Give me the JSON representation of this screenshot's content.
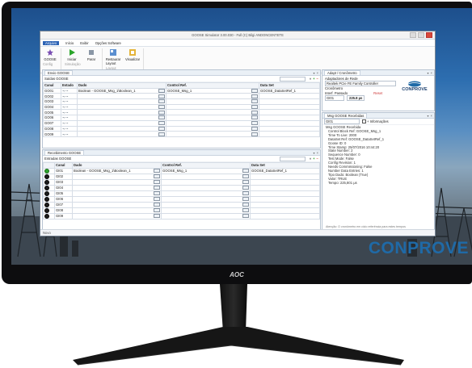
{
  "monitor": {
    "brand_logo": "AOC",
    "wallpaper_brand": "CONPROVE"
  },
  "app": {
    "title": "GOOSE Simulator 3.00.030 - Full (C) Bilgi ANDONCENTETE",
    "menu": [
      "Arquivo",
      "Início",
      "Exibir",
      "Opções Software"
    ],
    "menu_active_index": 1,
    "ribbon": {
      "groups": [
        {
          "caption": "Config",
          "buttons": [
            {
              "label": "GOOSE",
              "icon": "goose-icon"
            }
          ]
        },
        {
          "caption": "Simulação",
          "buttons": [
            {
              "label": "Iniciar",
              "icon": "play-icon"
            },
            {
              "label": "Parar",
              "icon": "stop-icon"
            }
          ]
        },
        {
          "caption": "Layout",
          "buttons": [
            {
              "label": "Restaurar Layout",
              "icon": "restore-layout-icon"
            },
            {
              "label": "Visualizar",
              "icon": "view-icon"
            }
          ]
        }
      ]
    },
    "envio_panel": {
      "tab": "Envio GOOSE",
      "subtitle": "Saídas GOOSE",
      "columns": [
        "Canal",
        "Estado",
        "Dado",
        "Control Ref.",
        "Data Set"
      ],
      "rows": [
        {
          "canal": "GO01",
          "estado": "~⌐~",
          "dado": "Boolean - GOOSE_Msg_1\\Boolean_1",
          "control": "GOOSE_Msg_1",
          "dataset": "GOOSE_DataSetRef_1"
        },
        {
          "canal": "GO02",
          "estado": "~⌐~",
          "dado": "",
          "control": "",
          "dataset": ""
        },
        {
          "canal": "GO03",
          "estado": "~⌐~",
          "dado": "",
          "control": "",
          "dataset": ""
        },
        {
          "canal": "GO04",
          "estado": "~⌐~",
          "dado": "",
          "control": "",
          "dataset": ""
        },
        {
          "canal": "GO05",
          "estado": "~⌐~",
          "dado": "",
          "control": "",
          "dataset": ""
        },
        {
          "canal": "GO06",
          "estado": "~⌐~",
          "dado": "",
          "control": "",
          "dataset": ""
        },
        {
          "canal": "GO07",
          "estado": "~⌐~",
          "dado": "",
          "control": "",
          "dataset": ""
        },
        {
          "canal": "GO08",
          "estado": "~⌐~",
          "dado": "",
          "control": "",
          "dataset": ""
        },
        {
          "canal": "GO09",
          "estado": "~⌐~",
          "dado": "",
          "control": "",
          "dataset": ""
        }
      ]
    },
    "recebimento_panel": {
      "tab": "Recebimento GOOSE",
      "subtitle": "Entradas GOOSE",
      "columns": [
        "",
        "Canal",
        "Dado",
        "Control Ref.",
        "Data Set"
      ],
      "rows": [
        {
          "led": "green",
          "canal": "GI01",
          "dado": "Boolean - GOOSE_Msg_1\\Boolean_1",
          "control": "GOOSE_Msg_1",
          "dataset": "GOOSE_DataSetRef_1"
        },
        {
          "led": "dark",
          "canal": "GI02",
          "dado": "",
          "control": "",
          "dataset": ""
        },
        {
          "led": "dark",
          "canal": "GI03",
          "dado": "",
          "control": "",
          "dataset": ""
        },
        {
          "led": "dark",
          "canal": "GI04",
          "dado": "",
          "control": "",
          "dataset": ""
        },
        {
          "led": "dark",
          "canal": "GI05",
          "dado": "",
          "control": "",
          "dataset": ""
        },
        {
          "led": "dark",
          "canal": "GI06",
          "dado": "",
          "control": "",
          "dataset": ""
        },
        {
          "led": "dark",
          "canal": "GI07",
          "dado": "",
          "control": "",
          "dataset": ""
        },
        {
          "led": "dark",
          "canal": "GI08",
          "dado": "",
          "control": "",
          "dataset": ""
        },
        {
          "led": "dark",
          "canal": "GI09",
          "dado": "",
          "control": "",
          "dataset": ""
        }
      ]
    },
    "adapter_panel": {
      "tab": "Adapt / Cronômetro",
      "section": "Adaptadores de Rede",
      "adapter_value": "Realtek PCIe FE Family Controller",
      "chrono_label": "Cronômetro",
      "chrono_sub": "Interf. Passado",
      "chrono_reset": "Reset",
      "chrono_channel": "GI01",
      "chrono_value": "225.8 µs",
      "logo_text": "CONPROVE"
    },
    "msg_panel": {
      "tab": "Msg GOOSE Recebidas",
      "select_value": "GI01",
      "checkbox_label": "+ Informações",
      "lines": [
        "Msg GOOSE Recebida",
        "Control Block Ref: GOOSE_Msg_1",
        "Time To Live: 2000",
        "DataSet Ref: GOOSE_DataSetRef_1",
        "Goose ID: 0",
        "Time Stamp: 25/07/2016 10:44:20",
        "State Number: 2",
        "Sequence Number: 0",
        "Test Mode: False",
        "Config Revision: 1",
        "Needs Commissioning: False",
        "Number Data Entries: 1",
        "Tipo Dado: Boolean (True)",
        "Valor: TRUE",
        "Tempo: 225,801 µs"
      ],
      "footer": "Atenção: O cronômetro em ciclo referência para estes tempos"
    },
    "status": {
      "left": "Novo",
      "right": ""
    }
  }
}
